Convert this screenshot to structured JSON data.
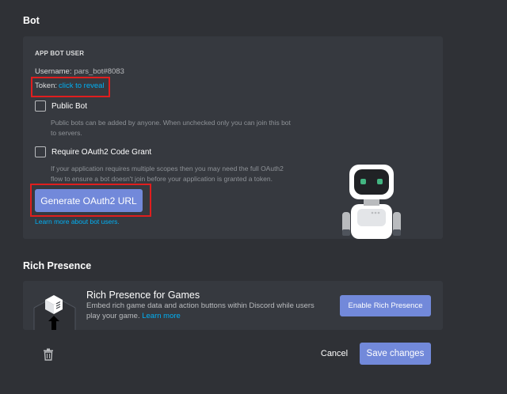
{
  "bot": {
    "section_title": "Bot",
    "eyebrow": "APP BOT USER",
    "username_label": "Username:",
    "username_value": "pars_bot#8083",
    "token_label": "Token:",
    "token_link": "click to reveal",
    "public_bot": {
      "label": "Public Bot",
      "checked": false,
      "description": "Public bots can be added by anyone. When unchecked only you can join this bot to servers."
    },
    "oauth_grant": {
      "label": "Require OAuth2 Code Grant",
      "checked": false,
      "description": "If your application requires multiple scopes then you may need the full OAuth2 flow to ensure a bot doesn't join before your application is granted a token."
    },
    "generate_button": "Generate OAuth2 URL",
    "learn_more": "Learn more about bot users."
  },
  "rich_presence": {
    "section_title": "Rich Presence",
    "title": "Rich Presence for Games",
    "description": "Embed rich game data and action buttons within Discord while users play your game.",
    "learn_more": "Learn more",
    "enable_button": "Enable Rich Presence"
  },
  "footer": {
    "cancel_label": "Cancel",
    "save_label": "Save changes"
  },
  "colors": {
    "background": "#2f3136",
    "card": "#36393f",
    "accent": "#7289da",
    "link": "#00b0f4",
    "highlight": "#e01e1e"
  },
  "icons": {
    "robot": "robot-illustration",
    "rich_presence": "cube-illustration",
    "trash": "trash-icon"
  }
}
